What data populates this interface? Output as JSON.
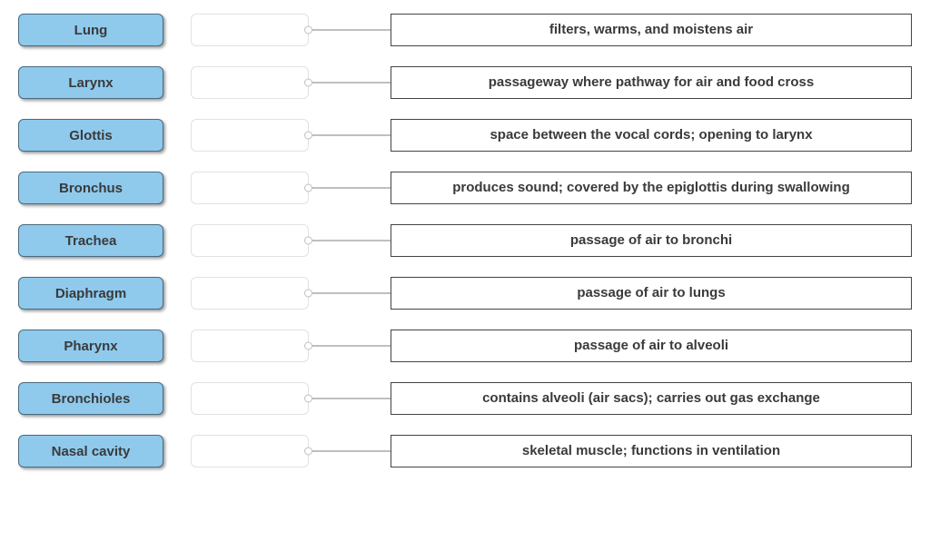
{
  "rows": [
    {
      "term": "Lung",
      "definition": "filters, warms, and moistens air"
    },
    {
      "term": "Larynx",
      "definition": "passageway where pathway for air and food cross"
    },
    {
      "term": "Glottis",
      "definition": "space between the vocal cords; opening to larynx"
    },
    {
      "term": "Bronchus",
      "definition": "produces sound; covered by the epiglottis during swallowing"
    },
    {
      "term": "Trachea",
      "definition": "passage of air to bronchi"
    },
    {
      "term": "Diaphragm",
      "definition": "passage of air to lungs"
    },
    {
      "term": "Pharynx",
      "definition": "passage of air to alveoli"
    },
    {
      "term": "Bronchioles",
      "definition": "contains alveoli (air sacs); carries out gas exchange"
    },
    {
      "term": "Nasal cavity",
      "definition": "skeletal muscle; functions in ventilation"
    }
  ],
  "colors": {
    "term_bg": "#8fcaed",
    "term_border": "#4a6a7f",
    "drop_border": "#e2e2e2",
    "connector": "#bfbfbf",
    "def_border": "#444",
    "text": "#3a3a3a"
  }
}
